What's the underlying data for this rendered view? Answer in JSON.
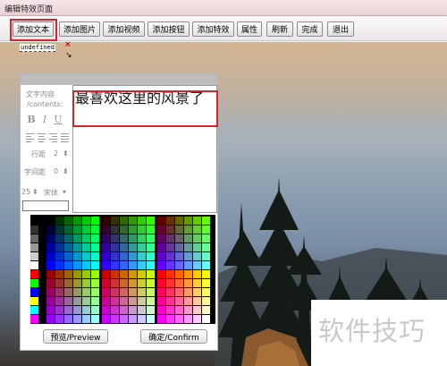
{
  "window": {
    "title": "编辑特效页面"
  },
  "toolbar": {
    "buttons": [
      {
        "label": "添加文本"
      },
      {
        "label": "添加图片"
      },
      {
        "label": "添加视频"
      },
      {
        "label": "添加按钮"
      },
      {
        "label": "添加特效"
      },
      {
        "label": "属性"
      },
      {
        "label": "刷新"
      },
      {
        "label": "完成"
      },
      {
        "label": "退出"
      }
    ]
  },
  "element_tag": {
    "text": "undefined",
    "close": "×",
    "resize": "↘"
  },
  "editor": {
    "contents_label": "文字内容",
    "contents_label_en": "/contents:",
    "format": {
      "bold": "B",
      "italic": "I",
      "underline": "U"
    },
    "line_spacing": {
      "label": "行距",
      "value": "2"
    },
    "letter_spacing": {
      "label": "字间距",
      "value": "0"
    },
    "font_size": {
      "value": "25"
    },
    "font_family": {
      "value": "宋体"
    },
    "text": "最喜欢这里的风景了",
    "preview_label": "预览/Preview",
    "confirm_label": "确定/Confirm"
  },
  "watermark": {
    "text": "软件技巧"
  },
  "colors": {
    "highlight": "#d8232a",
    "accent_text": "#111111"
  },
  "icons": [
    "chevron-up-down-icon",
    "bold-icon",
    "italic-icon",
    "underline-icon",
    "align-left-icon",
    "align-center-icon",
    "align-right-icon",
    "align-justify-icon",
    "close-icon",
    "resize-arrow-icon"
  ]
}
